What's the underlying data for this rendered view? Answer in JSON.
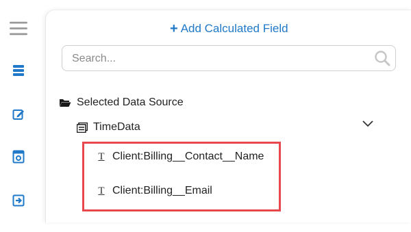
{
  "panel": {
    "add_calculated_field": {
      "label": "Add Calculated Field",
      "icon": "plus-icon",
      "color": "#1f78c8"
    },
    "search": {
      "placeholder": "Search...",
      "value": ""
    },
    "tree": {
      "root_label": "Selected Data Source",
      "dataset_label": "TimeData",
      "fields": [
        {
          "label": "Client:Billing__Contact__Name",
          "icon": "text-field-icon"
        },
        {
          "label": "Client:Billing__Email",
          "icon": "text-field-icon"
        }
      ]
    }
  },
  "left_rail": {
    "icons": [
      "menu-icon",
      "datasource-icon",
      "edit-icon",
      "settings-page-icon",
      "export-icon"
    ],
    "accent": "#1f78c8"
  },
  "highlight_color": "#e8474c"
}
